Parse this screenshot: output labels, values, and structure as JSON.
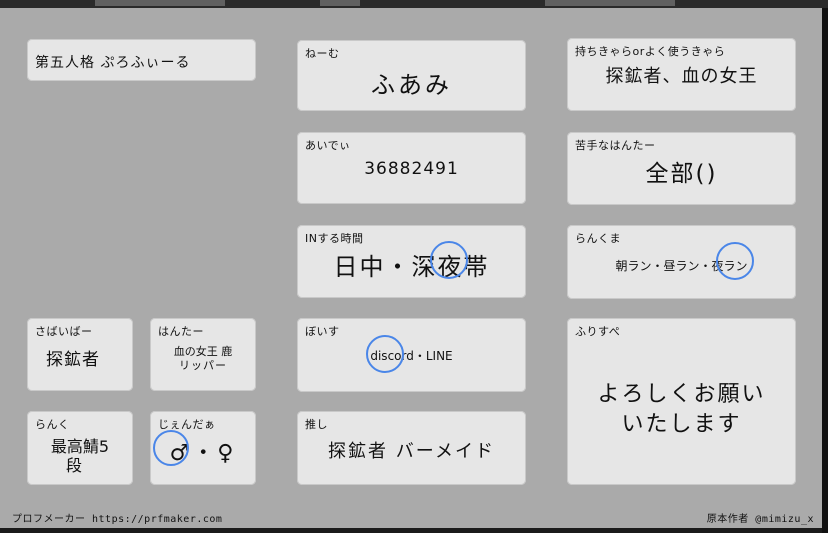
{
  "header": "第五人格 ぷろふぃーる",
  "fields": {
    "name": {
      "label": "ねーむ",
      "value": "ふあみ"
    },
    "id": {
      "label": "あいでぃ",
      "value": "36882491"
    },
    "in_time": {
      "label": "INする時間",
      "value": "日中・深夜帯"
    },
    "voice": {
      "label": "ぼいす",
      "value": "discord・LINE"
    },
    "oshi": {
      "label": "推し",
      "value": "探鉱者 バーメイド"
    },
    "main_chars": {
      "label": "持ちきゃらorよく使うきゃら",
      "value": "探鉱者、血の女王"
    },
    "weak_hunter": {
      "label": "苦手なはんたー",
      "value": "全部()"
    },
    "rank_match": {
      "label": "らんくま",
      "value": "朝ラン・昼ラン・夜ラン"
    },
    "survivor": {
      "label": "さばいばー",
      "value": "探鉱者"
    },
    "hunter": {
      "label": "はんたー",
      "value_line1": "血の女王 鹿",
      "value_line2": "リッパー"
    },
    "rank": {
      "label": "らんく",
      "value_line1": "最高鯖5",
      "value_line2": "段"
    },
    "gender": {
      "label": "じぇんだぁ",
      "value": "♂・♀"
    },
    "free": {
      "label": "ふりすぺ",
      "value_line1": "よろしくお願い",
      "value_line2": "いたします"
    }
  },
  "footer": {
    "maker": "プロフメーカー https://prfmaker.com",
    "author": "原本作者 @mimizu_x"
  },
  "colors": {
    "sheet": "#aaaaaa",
    "box": "#e6e6e6",
    "circle": "#4a86e8"
  }
}
